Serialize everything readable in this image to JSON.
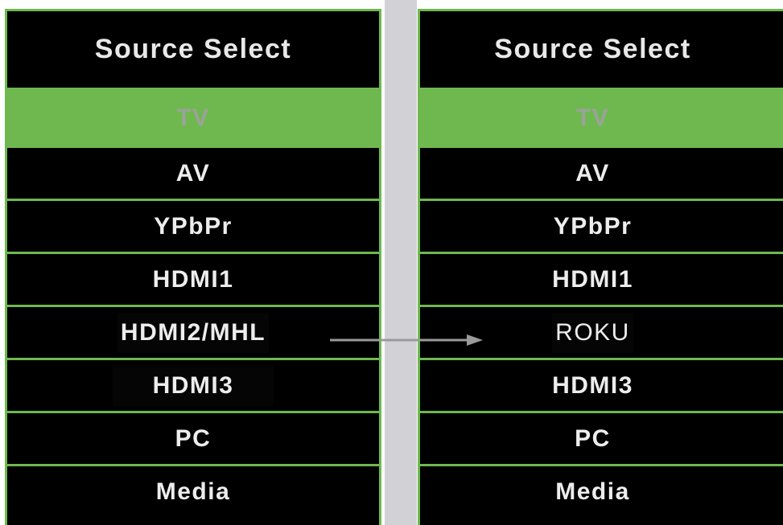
{
  "left_panel": {
    "title": "Source Select",
    "items": [
      {
        "label": "TV",
        "selected": true
      },
      {
        "label": "AV"
      },
      {
        "label": "YPbPr"
      },
      {
        "label": "HDMI1"
      },
      {
        "label": "HDMI2/MHL"
      },
      {
        "label": "HDMI3"
      },
      {
        "label": "PC"
      },
      {
        "label": "Media"
      }
    ]
  },
  "right_panel": {
    "title": "Source Select",
    "items": [
      {
        "label": "TV",
        "selected": true
      },
      {
        "label": "AV"
      },
      {
        "label": "YPbPr"
      },
      {
        "label": "HDMI1"
      },
      {
        "label": "ROKU"
      },
      {
        "label": "HDMI3"
      },
      {
        "label": "PC"
      },
      {
        "label": "Media"
      }
    ]
  },
  "colors": {
    "accent_green": "#6fb84f",
    "menu_background": "#000000",
    "divider_gray": "#d2d1d6",
    "arrow_gray": "#9a9a9a"
  },
  "arrow_icon": "right-arrow-icon"
}
